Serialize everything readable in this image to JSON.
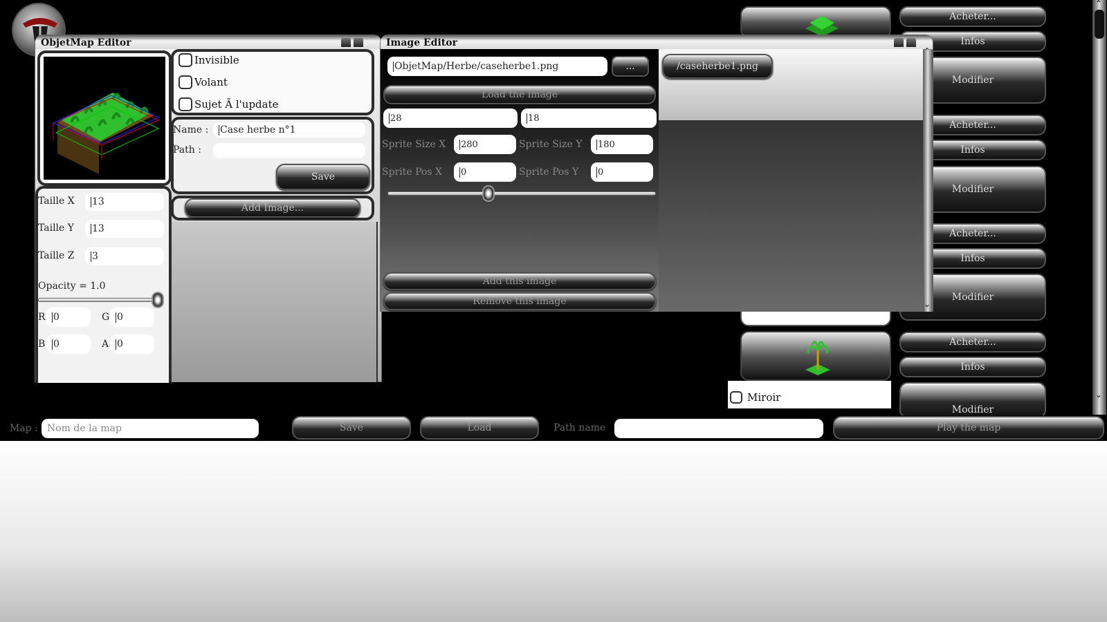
{
  "objetmap_editor": {
    "title": "ObjetMap Editor",
    "checkboxes": [
      "Invisible",
      "Volant",
      "Sujet Ã  l'update"
    ],
    "name_label": "Name :",
    "name_value": "Case herbe n°1",
    "path_label": "Path :",
    "path_value": "",
    "save_label": "Save",
    "add_image_label": "Add Image...",
    "taille_x_label": "Taille X",
    "taille_x_value": "13",
    "taille_y_label": "Taille Y",
    "taille_y_value": "13",
    "taille_z_label": "Taille Z",
    "taille_z_value": "3",
    "opacity_label": "Opacity = 1.0",
    "opacity": 1.0,
    "r_label": "R",
    "r_value": "0",
    "g_label": "G",
    "g_value": "0",
    "b_label": "B",
    "b_value": "0",
    "a_label": "A",
    "a_value": "0"
  },
  "image_editor": {
    "title": "Image Editor",
    "path_value": "ObjetMap/Herbe/caseherbe1.png",
    "browse_label": "...",
    "load_label": "Load the image",
    "field1_value": "28",
    "field2_value": "18",
    "sprite_size_x_label": "Sprite Size X",
    "sprite_size_x_value": "280",
    "sprite_size_y_label": "Sprite Size Y",
    "sprite_size_y_value": "180",
    "sprite_pos_x_label": "Sprite Pos X",
    "sprite_pos_x_value": "0",
    "sprite_pos_y_label": "Sprite Pos Y",
    "sprite_pos_y_value": "0",
    "slider_position": 0.37,
    "add_label": "Add this image",
    "remove_label": "Remove this image",
    "image_list": [
      "/caseherbe1.png"
    ]
  },
  "shop": {
    "acheter_label": "Acheter...",
    "infos_label": "Infos",
    "modifier_label": "Modifier",
    "miroir_label": "Miroir"
  },
  "bottom_bar": {
    "map_label": "Map :",
    "map_placeholder": "Nom de la map",
    "save_label": "Save",
    "load_label": "Load",
    "path_label": "Path name",
    "path_value": "",
    "play_label": "Play the map"
  },
  "colors": {
    "background": "#000000",
    "grass": "#2fbf2f",
    "panel_gray": "#d4d4d4"
  }
}
